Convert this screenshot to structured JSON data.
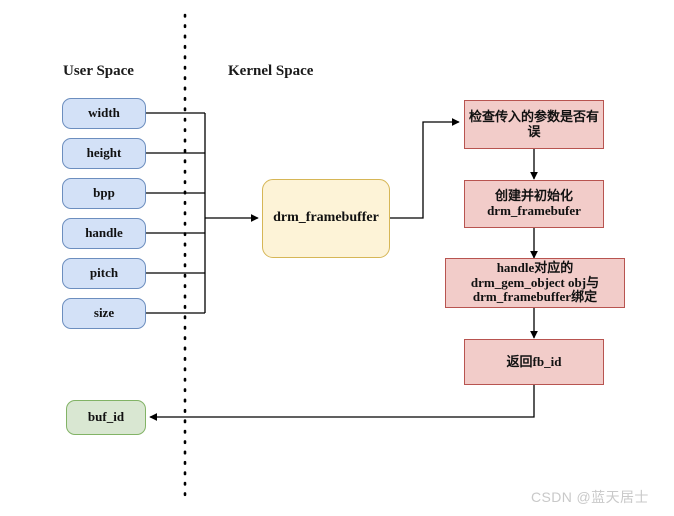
{
  "diagram": {
    "title_user_space": "User Space",
    "title_kernel_space": "Kernel Space",
    "colors": {
      "blue_fill": "#d3e1f7",
      "blue_border": "#6c8ebf",
      "yellow_fill": "#fdf3d7",
      "yellow_border": "#d6b656",
      "pink_fill": "#f2ccc9",
      "pink_border": "#b85450",
      "green_fill": "#d9e7d2",
      "green_border": "#82b366",
      "line": "#000000",
      "watermark": "#c9c9c9"
    },
    "params": [
      {
        "label": "width"
      },
      {
        "label": "height"
      },
      {
        "label": "bpp"
      },
      {
        "label": "handle"
      },
      {
        "label": "pitch"
      },
      {
        "label": "size"
      }
    ],
    "kernel_entry": {
      "label": "drm_framebuffer"
    },
    "steps": [
      {
        "line1": "检查传入的参数是否有误",
        "line2": "",
        "line3": ""
      },
      {
        "line1": "创建并初始化",
        "line2": "drm_framebufer",
        "line3": ""
      },
      {
        "line1": "handle对应的",
        "line2": "drm_gem_object obj与",
        "line3": "drm_framebuffer绑定"
      },
      {
        "line1": "返回fb_id",
        "line2": "",
        "line3": ""
      }
    ],
    "result": {
      "label": "buf_id"
    },
    "watermark": "CSDN @蓝天居士"
  }
}
